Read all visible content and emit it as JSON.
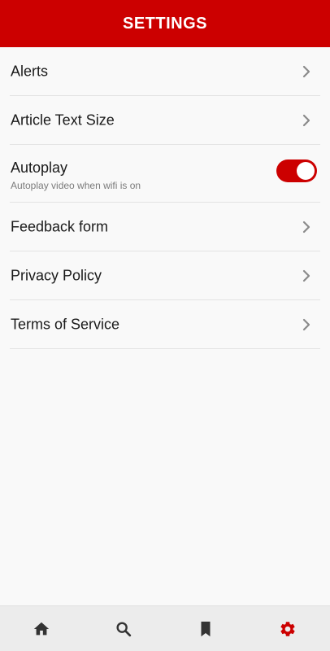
{
  "header": {
    "title": "SETTINGS"
  },
  "settings": {
    "items": [
      {
        "label": "Alerts",
        "icon": "chevron-right-icon"
      },
      {
        "label": "Article Text Size",
        "icon": "chevron-right-icon"
      },
      {
        "label": "Autoplay",
        "sublabel": "Autoplay video when wifi is on",
        "toggle_on": true
      },
      {
        "label": "Feedback form",
        "icon": "chevron-right-icon"
      },
      {
        "label": "Privacy Policy",
        "icon": "chevron-right-icon"
      },
      {
        "label": "Terms of Service",
        "icon": "chevron-right-icon"
      }
    ]
  },
  "bottom_nav": {
    "items": [
      {
        "icon": "home-icon",
        "active": false
      },
      {
        "icon": "search-icon",
        "active": false
      },
      {
        "icon": "bookmark-icon",
        "active": false
      },
      {
        "icon": "gear-icon",
        "active": true
      }
    ]
  },
  "colors": {
    "accent": "#cc0000",
    "nav_inactive": "#333333",
    "chevron": "#8a8a8a"
  }
}
